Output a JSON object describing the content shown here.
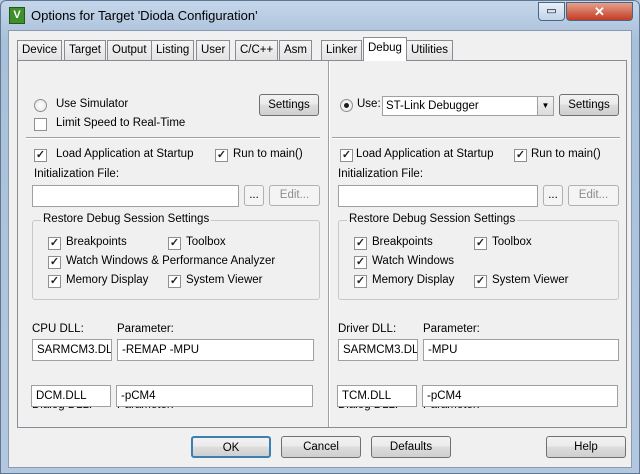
{
  "window": {
    "title": "Options for Target 'Dioda Configuration'",
    "icon_letter": "V",
    "close_glyph": "✕",
    "min_glyph": "▭"
  },
  "tabs": [
    "Device",
    "Target",
    "Output",
    "Listing",
    "User",
    "C/C++",
    "Asm",
    "Linker",
    "Debug",
    "Utilities"
  ],
  "left": {
    "use_simulator": "Use Simulator",
    "use_simulator_selected": false,
    "settings_label": "Settings",
    "limit_speed": "Limit Speed to Real-Time",
    "limit_speed_checked": false,
    "load_app": "Load Application at Startup",
    "load_app_checked": true,
    "run_to_main": "Run to main()",
    "run_to_main_checked": true,
    "init_file_label": "Initialization File:",
    "init_file_value": "",
    "browse_label": "...",
    "edit_label": "Edit...",
    "restore_title": "Restore Debug Session Settings",
    "breakpoints": "Breakpoints",
    "toolbox": "Toolbox",
    "watch": "Watch Windows & Performance Analyzer",
    "memory": "Memory Display",
    "system_viewer": "System Viewer",
    "cpu_dll_label": "CPU DLL:",
    "cpu_dll_value": "SARMCM3.DLL",
    "cpu_param_label": "Parameter:",
    "cpu_param_value": "-REMAP -MPU",
    "dialog_dll_label": "Dialog DLL:",
    "dialog_dll_value": "DCM.DLL",
    "dialog_param_label": "Parameter:",
    "dialog_param_value": "-pCM4"
  },
  "right": {
    "use_label": "Use:",
    "use_selected": true,
    "debugger": "ST-Link Debugger",
    "settings_label": "Settings",
    "load_app": "Load Application at Startup",
    "load_app_checked": true,
    "run_to_main": "Run to main()",
    "run_to_main_checked": true,
    "init_file_label": "Initialization File:",
    "init_file_value": "",
    "browse_label": "...",
    "edit_label": "Edit...",
    "restore_title": "Restore Debug Session Settings",
    "breakpoints": "Breakpoints",
    "toolbox": "Toolbox",
    "watch": "Watch Windows",
    "memory": "Memory Display",
    "system_viewer": "System Viewer",
    "driver_dll_label": "Driver DLL:",
    "driver_dll_value": "SARMCM3.DLL",
    "driver_param_label": "Parameter:",
    "driver_param_value": "-MPU",
    "dialog_dll_label": "Dialog DLL:",
    "dialog_dll_value": "TCM.DLL",
    "dialog_param_label": "Parameter:",
    "dialog_param_value": "-pCM4"
  },
  "buttons": {
    "ok": "OK",
    "cancel": "Cancel",
    "defaults": "Defaults",
    "help": "Help"
  },
  "check_glyph": "✓"
}
